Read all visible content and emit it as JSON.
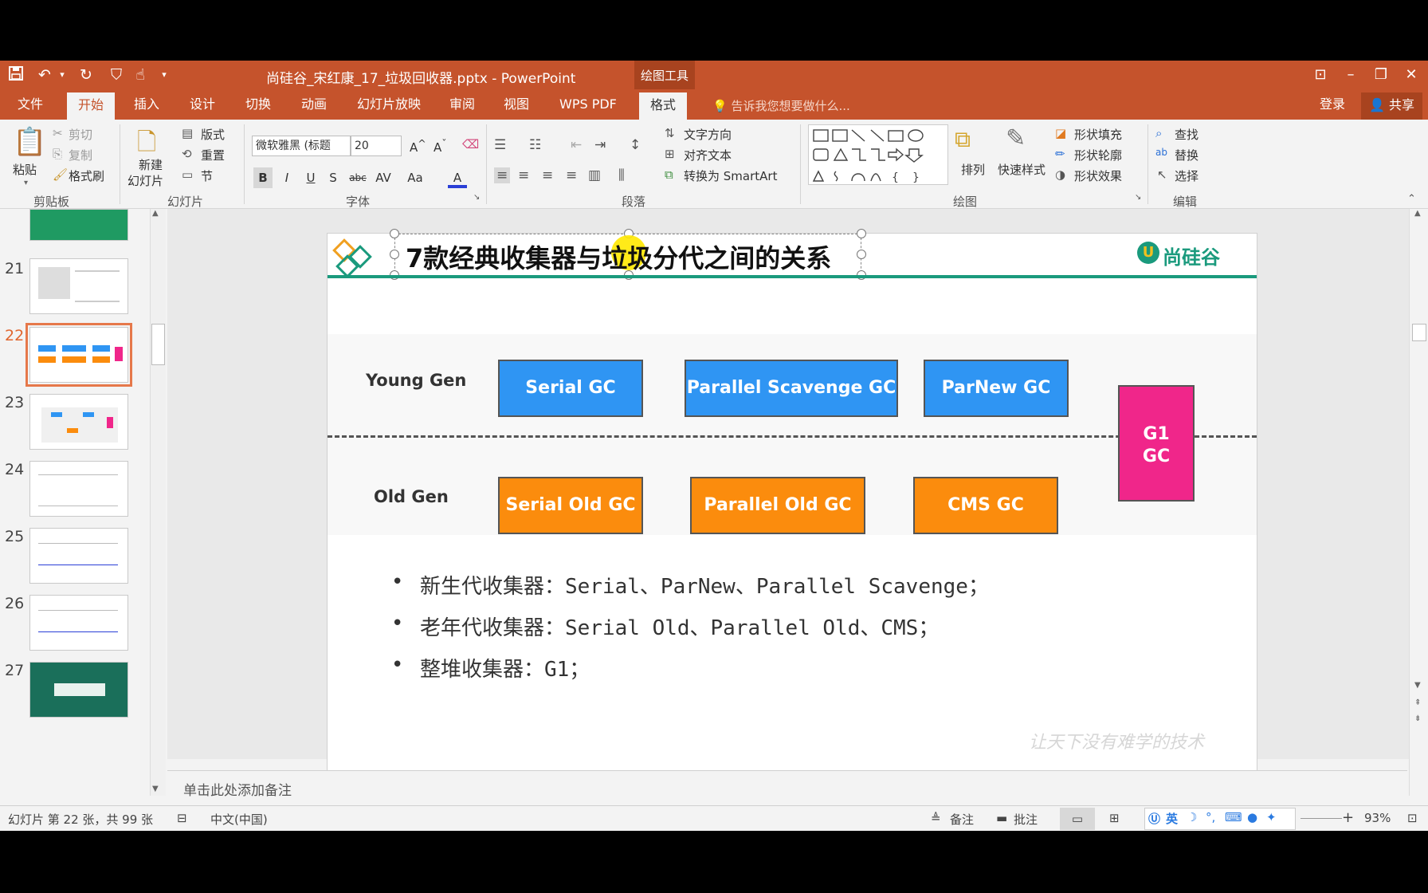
{
  "window": {
    "title": "尚硅谷_宋红康_17_垃圾回收器.pptx - PowerPoint",
    "context_group": "绘图工具",
    "tell_me": "告诉我您想要做什么...",
    "login": "登录",
    "share": "共享"
  },
  "tabs": [
    "文件",
    "开始",
    "插入",
    "设计",
    "切换",
    "动画",
    "幻灯片放映",
    "审阅",
    "视图",
    "WPS PDF",
    "格式"
  ],
  "active_tab": "开始",
  "ribbon": {
    "clipboard": {
      "paste": "粘贴",
      "cut": "剪切",
      "copy": "复制",
      "format_painter": "格式刷",
      "label": "剪贴板"
    },
    "slides": {
      "new_slide_1": "新建",
      "new_slide_2": "幻灯片",
      "layout": "版式",
      "reset": "重置",
      "section": "节",
      "label": "幻灯片"
    },
    "font": {
      "font_name": "微软雅黑 (标题",
      "font_size": "20",
      "label": "字体",
      "bold": "B",
      "italic": "I",
      "underline": "U",
      "shadow": "S",
      "strike": "abc",
      "spacing": "AV",
      "case": "Aa",
      "color": "A"
    },
    "paragraph": {
      "text_direction": "文字方向",
      "align_text": "对齐文本",
      "smartart": "转换为 SmartArt",
      "label": "段落"
    },
    "drawing": {
      "arrange": "排列",
      "quick_styles": "快速样式",
      "shape_fill": "形状填充",
      "shape_outline": "形状轮廓",
      "shape_effects": "形状效果",
      "label": "绘图"
    },
    "editing": {
      "find": "查找",
      "replace": "替换",
      "select": "选择",
      "label": "编辑"
    }
  },
  "thumbnails": [
    {
      "num": "21"
    },
    {
      "num": "22",
      "selected": true
    },
    {
      "num": "23"
    },
    {
      "num": "24"
    },
    {
      "num": "25"
    },
    {
      "num": "26"
    },
    {
      "num": "27"
    }
  ],
  "slide": {
    "title": "7款经典收集器与垃圾分代之间的关系",
    "logo_text": "尚硅谷",
    "young_label": "Young Gen",
    "old_label": "Old Gen",
    "young_collectors": [
      "Serial GC",
      "Parallel Scavenge GC",
      "ParNew GC"
    ],
    "old_collectors": [
      "Serial Old GC",
      "Parallel Old GC",
      "CMS GC"
    ],
    "g1_line1": "G1",
    "g1_line2": "GC",
    "bullets": [
      "新生代收集器：Serial、ParNew、Parallel Scavenge；",
      "老年代收集器：Serial Old、Parallel Old、CMS；",
      "整堆收集器：G1；"
    ],
    "watermark": "让天下没有难学的技术",
    "colors": {
      "young": "#2f95f3",
      "old": "#fb8c0d",
      "g1": "#f0268a",
      "accent": "#1a9a7d"
    }
  },
  "notes_placeholder": "单击此处添加备注",
  "status": {
    "slide_info": "幻灯片 第 22 张，共 99 张",
    "language": "中文(中国)",
    "notes": "备注",
    "comments": "批注",
    "ime": "英",
    "zoom": "93%"
  }
}
